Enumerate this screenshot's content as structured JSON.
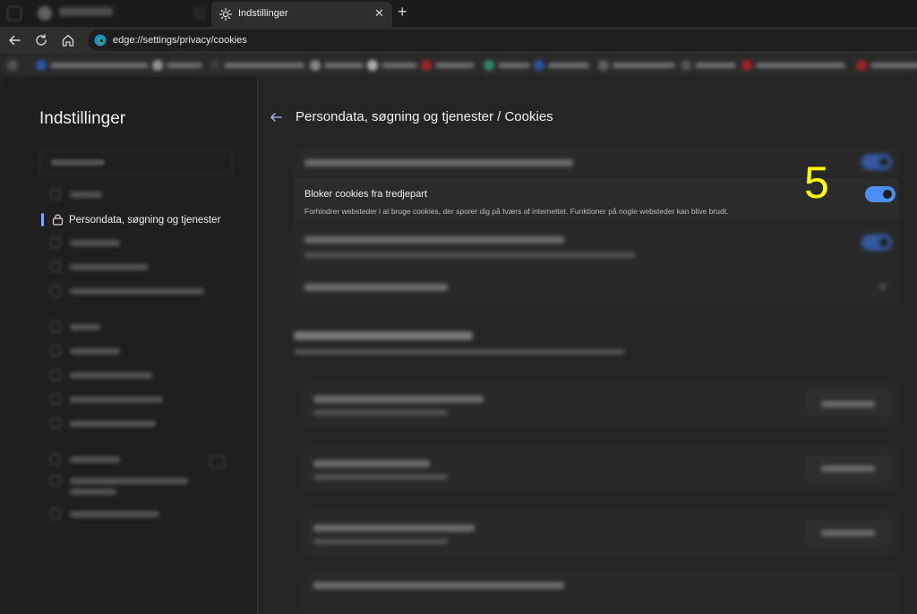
{
  "browser": {
    "active_tab": {
      "title": "Indstillinger",
      "close_glyph": "✕",
      "icon": "gear-icon"
    },
    "new_tab_glyph": "+",
    "address_bar": {
      "url": "edge://settings/privacy/cookies",
      "icon": "edge-logo-icon"
    }
  },
  "settings": {
    "sidebar": {
      "title": "Indstillinger",
      "active_item": {
        "label": "Persondata, søgning og tjenester",
        "icon": "lock-icon"
      }
    },
    "page": {
      "title": "Persondata, søgning og tjenester / Cookies",
      "back_icon": "arrow-left-icon"
    },
    "block_third_party": {
      "title": "Bloker cookies fra tredjepart",
      "description": "Forhindrer websteder i at bruge cookies, der sporer dig på tværs af internettet. Funktioner på nogle websteder kan blive brudt.",
      "enabled": true
    }
  },
  "annotation": {
    "step": "5",
    "color": "#ffff00"
  },
  "colors": {
    "accent": "#4d8ef5",
    "background": "#202020",
    "panel": "#2b2b2b"
  }
}
